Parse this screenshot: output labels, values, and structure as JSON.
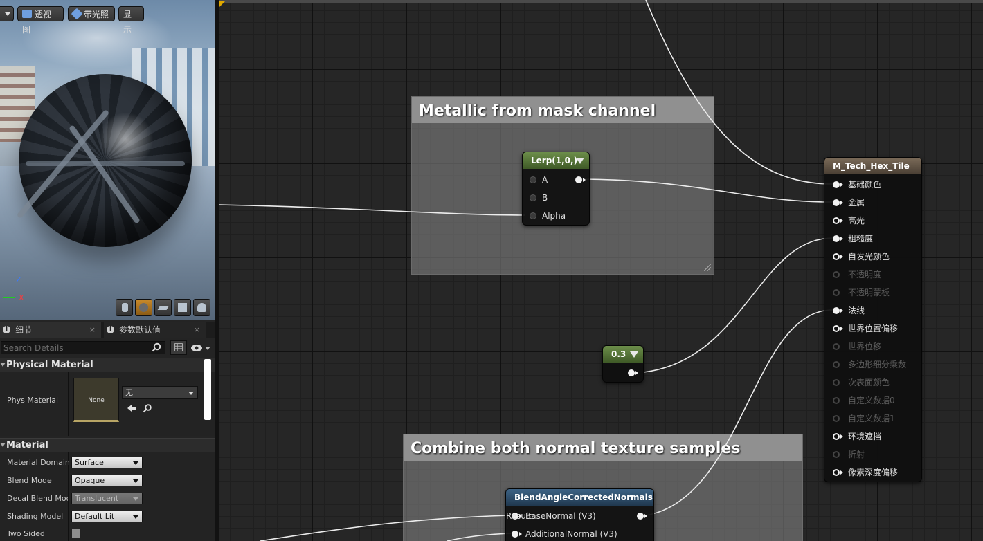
{
  "viewport": {
    "toolbar": {
      "perspective_label": "透视图",
      "lit_label": "带光照",
      "show_label": "显示"
    },
    "axis": {
      "z": "Z",
      "x": "X"
    }
  },
  "details": {
    "tabs": [
      {
        "label": "细节"
      },
      {
        "label": "参数默认值"
      }
    ],
    "tab_close": "×",
    "search_placeholder": "Search Details",
    "sections": {
      "physical_material": {
        "title": "Physical Material",
        "phys_material_label": "Phys Material",
        "thumb_label": "None",
        "combo_value": "无"
      },
      "material": {
        "title": "Material",
        "props": [
          {
            "label": "Material Domain",
            "value": "Surface"
          },
          {
            "label": "Blend Mode",
            "value": "Opaque"
          },
          {
            "label": "Decal Blend Mode",
            "value": "Translucent"
          },
          {
            "label": "Shading Model",
            "value": "Default Lit"
          },
          {
            "label": "Two Sided",
            "value": ""
          }
        ]
      }
    }
  },
  "graph": {
    "comments": [
      {
        "title": "Metallic from mask channel"
      },
      {
        "title": "Combine both normal texture samples"
      }
    ],
    "lerp_node": {
      "title": "Lerp(1,0,)",
      "header_color": "#5a7a3c",
      "inputs": [
        "A",
        "B",
        "Alpha"
      ]
    },
    "const_node": {
      "title": "0.3",
      "header_color": "#5a7a3c"
    },
    "blend_node": {
      "title": "BlendAngleCorrectedNormals",
      "header_color": "#2f4f6e",
      "inputs": [
        "BaseNormal (V3)",
        "AdditionalNormal (V3)"
      ],
      "output": "Result"
    },
    "result_node": {
      "title": "M_Tech_Hex_Tile",
      "header_color": "#6b5c4c",
      "pins": [
        {
          "label": "基础颜色",
          "state": "connected"
        },
        {
          "label": "金属",
          "state": "connected"
        },
        {
          "label": "高光",
          "state": "open"
        },
        {
          "label": "粗糙度",
          "state": "connected"
        },
        {
          "label": "自发光颜色",
          "state": "open"
        },
        {
          "label": "不透明度",
          "state": "disabled"
        },
        {
          "label": "不透明蒙板",
          "state": "disabled"
        },
        {
          "label": "法线",
          "state": "connected"
        },
        {
          "label": "世界位置偏移",
          "state": "open"
        },
        {
          "label": "世界位移",
          "state": "disabled"
        },
        {
          "label": "多边形细分乘数",
          "state": "disabled"
        },
        {
          "label": "次表面颜色",
          "state": "disabled"
        },
        {
          "label": "自定义数据0",
          "state": "disabled"
        },
        {
          "label": "自定义数据1",
          "state": "disabled"
        },
        {
          "label": "环境遮挡",
          "state": "open"
        },
        {
          "label": "折射",
          "state": "disabled"
        },
        {
          "label": "像素深度偏移",
          "state": "open"
        }
      ]
    }
  }
}
